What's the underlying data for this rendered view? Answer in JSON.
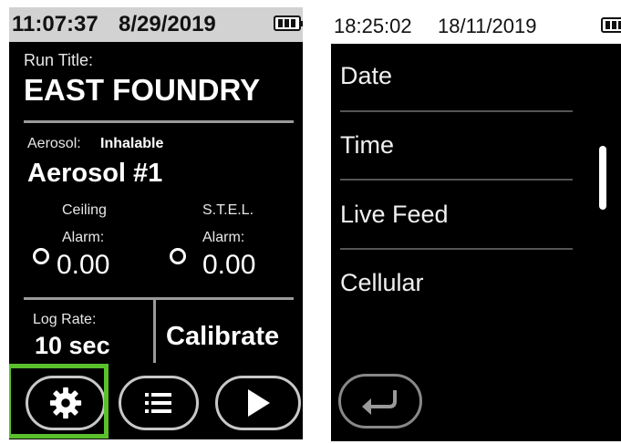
{
  "left_screen": {
    "status": {
      "time": "11:07:37",
      "date": "8/29/2019"
    },
    "run_title_label": "Run Title:",
    "run_title": "EAST FOUNDRY",
    "aerosol_label": "Aerosol:",
    "aerosol_type": "Inhalable",
    "aerosol_name": "Aerosol #1",
    "ceiling": {
      "title": "Ceiling",
      "alarm_label": "Alarm:",
      "value": "0.00"
    },
    "stel": {
      "title": "S.T.E.L.",
      "alarm_label": "Alarm:",
      "value": "0.00"
    },
    "log_rate_label": "Log Rate:",
    "log_rate_value": "10 sec",
    "calibrate_label": "Calibrate",
    "buttons": {
      "settings_icon": "gear-icon",
      "list_icon": "list-icon",
      "play_icon": "play-icon"
    },
    "highlight_color": "#5ac02c"
  },
  "right_screen": {
    "status": {
      "time": "18:25:02",
      "date": "18/11/2019"
    },
    "menu": [
      {
        "label": "Date"
      },
      {
        "label": "Time"
      },
      {
        "label": "Live Feed"
      },
      {
        "label": "Cellular"
      }
    ],
    "back_icon": "back-arrow-icon"
  }
}
